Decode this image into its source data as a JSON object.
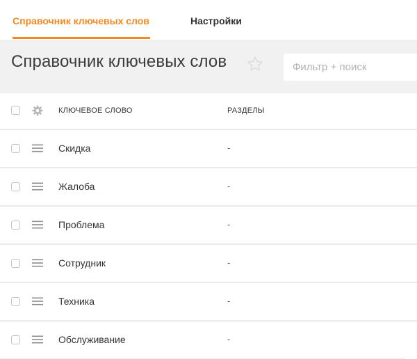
{
  "tabs": {
    "keywords": "Справочник ключевых слов",
    "settings": "Настройки"
  },
  "header": {
    "title": "Справочник ключевых слов",
    "favorite_icon": "star-outline-icon",
    "search_placeholder": "Фильтр + поиск",
    "search_value": ""
  },
  "table": {
    "columns": {
      "keyword": "Ключевое слово",
      "sections": "Разделы"
    },
    "settings_icon": "gear-icon",
    "row_handle_icon": "drag-handle-icon",
    "rows": [
      {
        "keyword": "Скидка",
        "sections": "-"
      },
      {
        "keyword": "Жалоба",
        "sections": "-"
      },
      {
        "keyword": "Проблема",
        "sections": "-"
      },
      {
        "keyword": "Сотрудник",
        "sections": "-"
      },
      {
        "keyword": "Техника",
        "sections": "-"
      },
      {
        "keyword": "Обслуживание",
        "sections": "-"
      }
    ]
  },
  "colors": {
    "accent": "#f4891f",
    "header_band": "#f1f1f1",
    "divider": "#ebebeb"
  }
}
